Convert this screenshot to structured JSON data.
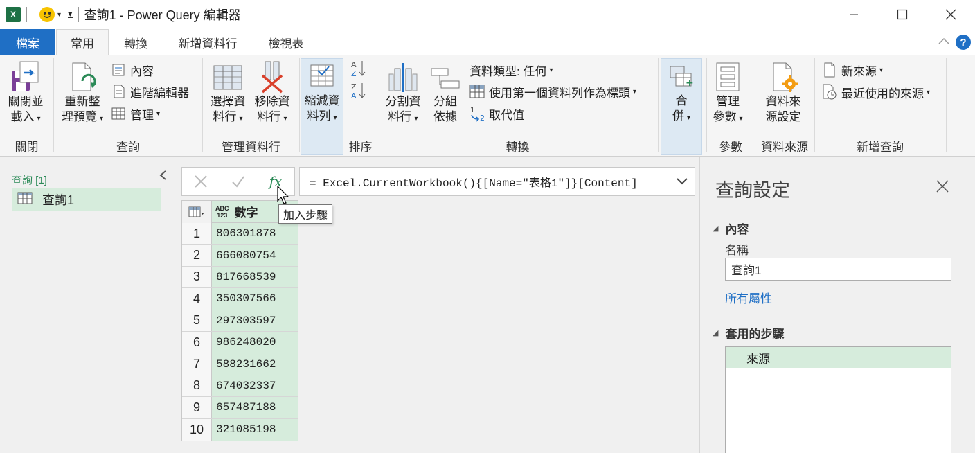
{
  "window": {
    "title": "查詢1 - Power Query 編輯器",
    "app_icon": "X"
  },
  "tabs": [
    "檔案",
    "常用",
    "轉換",
    "新增資料行",
    "檢視表"
  ],
  "ribbon": {
    "close_load": {
      "line1": "關閉並",
      "line2": "載入"
    },
    "refresh": {
      "line1": "重新整",
      "line2": "理預覽"
    },
    "properties": "內容",
    "advanced_editor": "進階編輯器",
    "manage": "管理",
    "choose_columns": {
      "line1": "選擇資",
      "line2": "料行"
    },
    "remove_columns": {
      "line1": "移除資",
      "line2": "料行"
    },
    "reduce_rows": {
      "line1": "縮減資",
      "line2": "料列"
    },
    "split_column": {
      "line1": "分割資",
      "line2": "料行"
    },
    "group_by": {
      "line1": "分組",
      "line2": "依據"
    },
    "data_type": "資料類型: 任何",
    "first_row_header": "使用第一個資料列作為標頭",
    "replace_values": "取代值",
    "combine": {
      "line1": "合",
      "line2": "併"
    },
    "manage_params": {
      "line1": "管理",
      "line2": "參數"
    },
    "data_source_settings": {
      "line1": "資料來",
      "line2": "源設定"
    },
    "new_source": "新來源",
    "recent_sources": "最近使用的來源",
    "groups": {
      "close": "關閉",
      "query": "查詢",
      "manage_columns": "管理資料行",
      "sort": "排序",
      "transform": "轉換",
      "params": "參數",
      "data_sources": "資料來源",
      "new_query": "新增查詢"
    }
  },
  "queries_pane": {
    "header": "查詢 [1]",
    "items": [
      {
        "label": "查詢1"
      }
    ]
  },
  "formula_bar": {
    "formula": "= Excel.CurrentWorkbook(){[Name=\"表格1\"]}[Content]",
    "tooltip": "加入步驟"
  },
  "grid": {
    "column": {
      "name": "數字",
      "type_top": "ABC",
      "type_bottom": "123"
    },
    "rows": [
      {
        "n": "1",
        "v": "806301878"
      },
      {
        "n": "2",
        "v": "666080754"
      },
      {
        "n": "3",
        "v": "817668539"
      },
      {
        "n": "4",
        "v": "350307566"
      },
      {
        "n": "5",
        "v": "297303597"
      },
      {
        "n": "6",
        "v": "986248020"
      },
      {
        "n": "7",
        "v": "588231662"
      },
      {
        "n": "8",
        "v": "674032337"
      },
      {
        "n": "9",
        "v": "657487188"
      },
      {
        "n": "10",
        "v": "321085198"
      }
    ]
  },
  "settings_pane": {
    "title": "查詢設定",
    "properties_section": "內容",
    "name_label": "名稱",
    "name_value": "查詢1",
    "all_properties": "所有屬性",
    "steps_section": "套用的步驟",
    "steps": [
      {
        "label": "來源"
      }
    ]
  },
  "colors": {
    "accent": "#1f6fc5",
    "green": "#2b8a57",
    "selection": "#d6ecdc"
  }
}
